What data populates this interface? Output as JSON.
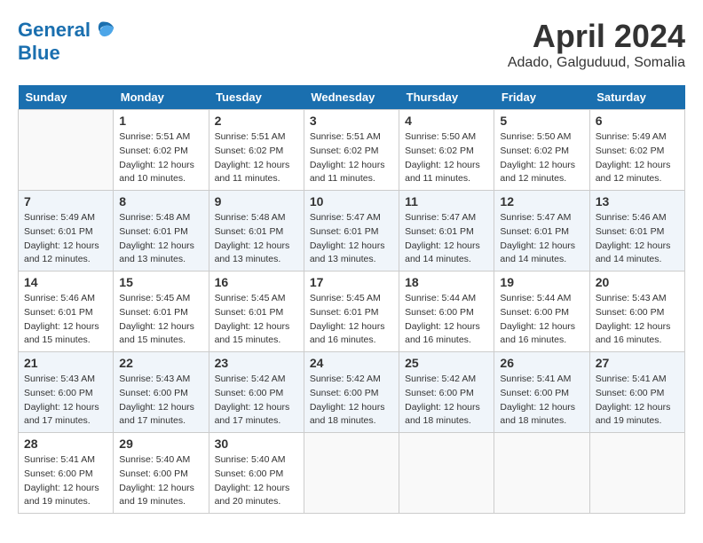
{
  "header": {
    "logo_line1": "General",
    "logo_line2": "Blue",
    "month": "April 2024",
    "location": "Adado, Galguduud, Somalia"
  },
  "weekdays": [
    "Sunday",
    "Monday",
    "Tuesday",
    "Wednesday",
    "Thursday",
    "Friday",
    "Saturday"
  ],
  "weeks": [
    [
      {
        "day": "",
        "sunrise": "",
        "sunset": "",
        "daylight": ""
      },
      {
        "day": "1",
        "sunrise": "Sunrise: 5:51 AM",
        "sunset": "Sunset: 6:02 PM",
        "daylight": "Daylight: 12 hours and 10 minutes."
      },
      {
        "day": "2",
        "sunrise": "Sunrise: 5:51 AM",
        "sunset": "Sunset: 6:02 PM",
        "daylight": "Daylight: 12 hours and 11 minutes."
      },
      {
        "day": "3",
        "sunrise": "Sunrise: 5:51 AM",
        "sunset": "Sunset: 6:02 PM",
        "daylight": "Daylight: 12 hours and 11 minutes."
      },
      {
        "day": "4",
        "sunrise": "Sunrise: 5:50 AM",
        "sunset": "Sunset: 6:02 PM",
        "daylight": "Daylight: 12 hours and 11 minutes."
      },
      {
        "day": "5",
        "sunrise": "Sunrise: 5:50 AM",
        "sunset": "Sunset: 6:02 PM",
        "daylight": "Daylight: 12 hours and 12 minutes."
      },
      {
        "day": "6",
        "sunrise": "Sunrise: 5:49 AM",
        "sunset": "Sunset: 6:02 PM",
        "daylight": "Daylight: 12 hours and 12 minutes."
      }
    ],
    [
      {
        "day": "7",
        "sunrise": "Sunrise: 5:49 AM",
        "sunset": "Sunset: 6:01 PM",
        "daylight": "Daylight: 12 hours and 12 minutes."
      },
      {
        "day": "8",
        "sunrise": "Sunrise: 5:48 AM",
        "sunset": "Sunset: 6:01 PM",
        "daylight": "Daylight: 12 hours and 13 minutes."
      },
      {
        "day": "9",
        "sunrise": "Sunrise: 5:48 AM",
        "sunset": "Sunset: 6:01 PM",
        "daylight": "Daylight: 12 hours and 13 minutes."
      },
      {
        "day": "10",
        "sunrise": "Sunrise: 5:47 AM",
        "sunset": "Sunset: 6:01 PM",
        "daylight": "Daylight: 12 hours and 13 minutes."
      },
      {
        "day": "11",
        "sunrise": "Sunrise: 5:47 AM",
        "sunset": "Sunset: 6:01 PM",
        "daylight": "Daylight: 12 hours and 14 minutes."
      },
      {
        "day": "12",
        "sunrise": "Sunrise: 5:47 AM",
        "sunset": "Sunset: 6:01 PM",
        "daylight": "Daylight: 12 hours and 14 minutes."
      },
      {
        "day": "13",
        "sunrise": "Sunrise: 5:46 AM",
        "sunset": "Sunset: 6:01 PM",
        "daylight": "Daylight: 12 hours and 14 minutes."
      }
    ],
    [
      {
        "day": "14",
        "sunrise": "Sunrise: 5:46 AM",
        "sunset": "Sunset: 6:01 PM",
        "daylight": "Daylight: 12 hours and 15 minutes."
      },
      {
        "day": "15",
        "sunrise": "Sunrise: 5:45 AM",
        "sunset": "Sunset: 6:01 PM",
        "daylight": "Daylight: 12 hours and 15 minutes."
      },
      {
        "day": "16",
        "sunrise": "Sunrise: 5:45 AM",
        "sunset": "Sunset: 6:01 PM",
        "daylight": "Daylight: 12 hours and 15 minutes."
      },
      {
        "day": "17",
        "sunrise": "Sunrise: 5:45 AM",
        "sunset": "Sunset: 6:01 PM",
        "daylight": "Daylight: 12 hours and 16 minutes."
      },
      {
        "day": "18",
        "sunrise": "Sunrise: 5:44 AM",
        "sunset": "Sunset: 6:00 PM",
        "daylight": "Daylight: 12 hours and 16 minutes."
      },
      {
        "day": "19",
        "sunrise": "Sunrise: 5:44 AM",
        "sunset": "Sunset: 6:00 PM",
        "daylight": "Daylight: 12 hours and 16 minutes."
      },
      {
        "day": "20",
        "sunrise": "Sunrise: 5:43 AM",
        "sunset": "Sunset: 6:00 PM",
        "daylight": "Daylight: 12 hours and 16 minutes."
      }
    ],
    [
      {
        "day": "21",
        "sunrise": "Sunrise: 5:43 AM",
        "sunset": "Sunset: 6:00 PM",
        "daylight": "Daylight: 12 hours and 17 minutes."
      },
      {
        "day": "22",
        "sunrise": "Sunrise: 5:43 AM",
        "sunset": "Sunset: 6:00 PM",
        "daylight": "Daylight: 12 hours and 17 minutes."
      },
      {
        "day": "23",
        "sunrise": "Sunrise: 5:42 AM",
        "sunset": "Sunset: 6:00 PM",
        "daylight": "Daylight: 12 hours and 17 minutes."
      },
      {
        "day": "24",
        "sunrise": "Sunrise: 5:42 AM",
        "sunset": "Sunset: 6:00 PM",
        "daylight": "Daylight: 12 hours and 18 minutes."
      },
      {
        "day": "25",
        "sunrise": "Sunrise: 5:42 AM",
        "sunset": "Sunset: 6:00 PM",
        "daylight": "Daylight: 12 hours and 18 minutes."
      },
      {
        "day": "26",
        "sunrise": "Sunrise: 5:41 AM",
        "sunset": "Sunset: 6:00 PM",
        "daylight": "Daylight: 12 hours and 18 minutes."
      },
      {
        "day": "27",
        "sunrise": "Sunrise: 5:41 AM",
        "sunset": "Sunset: 6:00 PM",
        "daylight": "Daylight: 12 hours and 19 minutes."
      }
    ],
    [
      {
        "day": "28",
        "sunrise": "Sunrise: 5:41 AM",
        "sunset": "Sunset: 6:00 PM",
        "daylight": "Daylight: 12 hours and 19 minutes."
      },
      {
        "day": "29",
        "sunrise": "Sunrise: 5:40 AM",
        "sunset": "Sunset: 6:00 PM",
        "daylight": "Daylight: 12 hours and 19 minutes."
      },
      {
        "day": "30",
        "sunrise": "Sunrise: 5:40 AM",
        "sunset": "Sunset: 6:00 PM",
        "daylight": "Daylight: 12 hours and 20 minutes."
      },
      {
        "day": "",
        "sunrise": "",
        "sunset": "",
        "daylight": ""
      },
      {
        "day": "",
        "sunrise": "",
        "sunset": "",
        "daylight": ""
      },
      {
        "day": "",
        "sunrise": "",
        "sunset": "",
        "daylight": ""
      },
      {
        "day": "",
        "sunrise": "",
        "sunset": "",
        "daylight": ""
      }
    ]
  ]
}
